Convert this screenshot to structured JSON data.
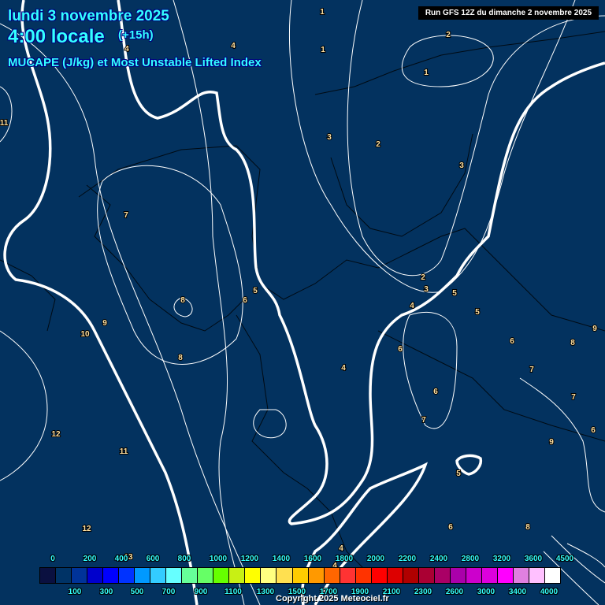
{
  "header": {
    "date": "lundi 3 novembre 2025",
    "time": "4:00 locale",
    "lead": "(+15h)",
    "parameter": "MUCAPE (J/kg) et Most Unstable Lifted Index",
    "run": "Run GFS 12Z du dimanche 2 novembre 2025"
  },
  "legend": {
    "colors": [
      "#0a1040",
      "#003366",
      "#003399",
      "#0000cc",
      "#0000ff",
      "#0033ff",
      "#0099ff",
      "#33ccff",
      "#66ffff",
      "#66ff99",
      "#66ff66",
      "#66ff00",
      "#c8f014",
      "#ffff00",
      "#ffff80",
      "#ffe050",
      "#ffcc00",
      "#ff9900",
      "#ff6600",
      "#ff3333",
      "#ff3300",
      "#ff0000",
      "#dd0000",
      "#b00000",
      "#aa0033",
      "#aa0066",
      "#aa00aa",
      "#cc00cc",
      "#dd00dd",
      "#ff00ff",
      "#e080e0",
      "#ffc0ff",
      "#ffffff"
    ],
    "top_labels": [
      "0",
      "200",
      "400",
      "600",
      "800",
      "1000",
      "1200",
      "1400",
      "1600",
      "1800",
      "2000",
      "2200",
      "2400",
      "2800",
      "3200",
      "3600",
      "4500"
    ],
    "bottom_labels": [
      "100",
      "300",
      "500",
      "700",
      "900",
      "1100",
      "1300",
      "1500",
      "1700",
      "1900",
      "2100",
      "2300",
      "2600",
      "3000",
      "3400",
      "4000"
    ]
  },
  "contour_labels": [
    "1",
    "2",
    "1",
    "4",
    "4",
    "1",
    "11",
    "3",
    "2",
    "3",
    "7",
    "8",
    "6",
    "5",
    "2",
    "3",
    "4",
    "5",
    "5",
    "9",
    "10",
    "8",
    "6",
    "4",
    "6",
    "8",
    "7",
    "9",
    "7",
    "6",
    "7",
    "12",
    "11",
    "12",
    "13",
    "4",
    "4",
    "5",
    "6",
    "8",
    "9",
    "6"
  ],
  "copyright": "Copyright 2025 Meteociel.fr"
}
